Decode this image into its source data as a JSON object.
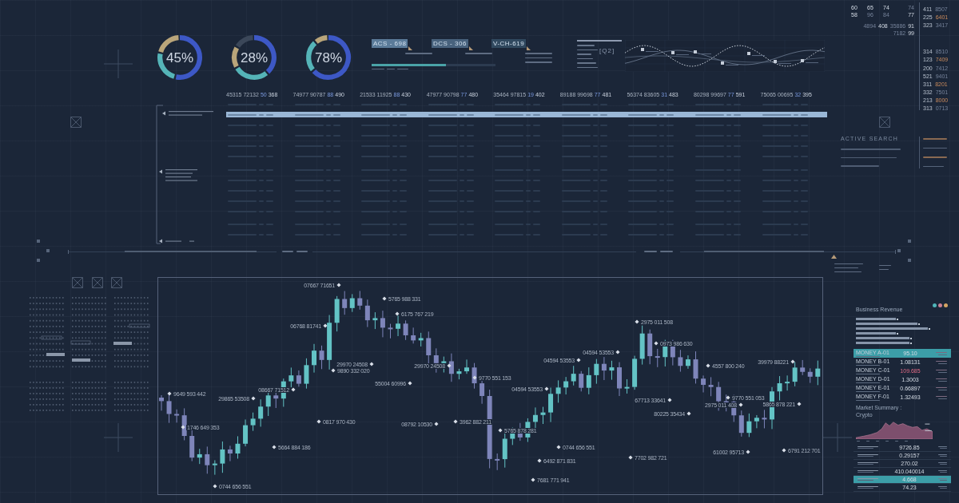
{
  "gauges": [
    {
      "value": "45%"
    },
    {
      "value": "28%"
    },
    {
      "value": "78%"
    }
  ],
  "tags": [
    {
      "label": "ACS - 698",
      "color": "#5b7b99"
    },
    {
      "label": "DCS - 306",
      "color": "#48627d"
    },
    {
      "label": "V-CH-619",
      "color": "#31495f"
    }
  ],
  "progress": {
    "level": 0.6
  },
  "wave_panel": {
    "label": "[Q2]"
  },
  "table": {
    "header_cells": [
      {
        "part_1": "45315 72132",
        "part_2": "50",
        "part_3": "368"
      },
      {
        "part_1": "74977 90787",
        "part_2": "88",
        "part_3": "490"
      },
      {
        "part_1": "21533 11925",
        "part_2": "88",
        "part_3": "430"
      },
      {
        "part_1": "47977 90798",
        "part_2": "77",
        "part_3": "480"
      },
      {
        "part_1": "35464 97815",
        "part_2": "19",
        "part_3": "402"
      },
      {
        "part_1": "89188 99698",
        "part_2": "77",
        "part_3": "481"
      },
      {
        "part_1": "56374 83605",
        "part_2": "31",
        "part_3": "483"
      },
      {
        "part_1": "80298 99697",
        "part_2": "77",
        "part_3": "591"
      },
      {
        "part_1": "75065 00695",
        "part_2": "32",
        "part_3": "395"
      }
    ]
  },
  "top_numbers": [
    [
      {
        "text": "60",
        "bright": true
      },
      {
        "text": "65",
        "bright": true
      },
      {
        "text": "74",
        "bright": true
      },
      {
        "text": "74",
        "bright": false
      }
    ],
    [
      {
        "text": "58",
        "bright": true
      },
      {
        "text": "96",
        "bright": false
      },
      {
        "text": "84",
        "bright": false
      },
      {
        "text": "77",
        "bright": true
      }
    ],
    [
      {
        "text": "4894",
        "bright": false
      },
      {
        "text": "408",
        "bright": true
      },
      {
        "text": "35886",
        "bright": false
      },
      {
        "text": "91",
        "bright": true
      }
    ],
    [
      {
        "text": "7182",
        "bright": false
      },
      {
        "text": "99",
        "bright": true
      }
    ]
  ],
  "side_readings": [
    [
      {
        "code": "411",
        "value": "8507",
        "highlight": false
      },
      {
        "code": "225",
        "value": "6401",
        "highlight": true
      },
      {
        "code": "323",
        "value": "3417",
        "highlight": false
      }
    ],
    [
      {
        "code": "314",
        "value": "8510",
        "highlight": false
      },
      {
        "code": "123",
        "value": "7409",
        "highlight": true
      },
      {
        "code": "200",
        "value": "7412",
        "highlight": false
      },
      {
        "code": "521",
        "value": "9401",
        "highlight": false
      },
      {
        "code": "311",
        "value": "8201",
        "highlight": true
      },
      {
        "code": "332",
        "value": "7501",
        "highlight": false
      },
      {
        "code": "213",
        "value": "8000",
        "highlight": true
      },
      {
        "code": "313",
        "value": "0713",
        "highlight": false
      }
    ]
  ],
  "active_search": {
    "title": "ACTIVE SEARCH"
  },
  "chart_labels": [
    "07667 71651",
    "5765 988 331",
    "06768 81741",
    "6175 767 219",
    "29970 24508",
    "9890 332 020",
    "29970 24508",
    "9770 551 153",
    "55004 60996",
    "9649 593 442",
    "29865 53508",
    "08667 71512",
    "0817 970 430",
    "08792 10530",
    "3962 882 211",
    "1746 649 353",
    "5664 884 186",
    "0744 656 551",
    "5765 878 281",
    "6492 871 831",
    "7681 771 941",
    "0744 656 551",
    "04594 53553",
    "04594 53553",
    "04594 53553",
    "2975 011 508",
    "0973 986 630",
    "67713 33641",
    "7702 982 721",
    "80225 35434",
    "4557 800 240",
    "9770 551 053",
    "2975 011 408",
    "61002 95713",
    "39979 88221",
    "5865 878 221",
    "6791 212 701"
  ],
  "revenue_panel": {
    "title": "Business Revenue",
    "legend_dots": [
      {
        "color": "#4fb4b9"
      },
      {
        "color": "#c97f93"
      },
      {
        "color": "#d4a463"
      }
    ],
    "rows": [
      {
        "name": "MONEY A-01",
        "value": "95.10",
        "selected": true,
        "alert": false
      },
      {
        "name": "MONEY B-01",
        "value": "1.08131",
        "selected": false,
        "alert": false
      },
      {
        "name": "MONEY C-01",
        "value": "109.685",
        "selected": false,
        "alert": true
      },
      {
        "name": "MONEY D-01",
        "value": "1.3003",
        "selected": false,
        "alert": false
      },
      {
        "name": "MONEY E-01",
        "value": "0.66897",
        "selected": false,
        "alert": false
      },
      {
        "name": "MONEY F-01",
        "value": "1.32493",
        "selected": false,
        "alert": false
      }
    ]
  },
  "market_summary": {
    "title": "Market Summary :",
    "subtitle": "Crypto",
    "rows": [
      {
        "value": "9726.85",
        "selected": false
      },
      {
        "value": "0.29157",
        "selected": false
      },
      {
        "value": "270.02",
        "selected": false
      },
      {
        "value": "410.040014",
        "selected": false
      },
      {
        "value": "4.668",
        "selected": true
      },
      {
        "value": "74.23",
        "selected": false
      }
    ]
  }
}
